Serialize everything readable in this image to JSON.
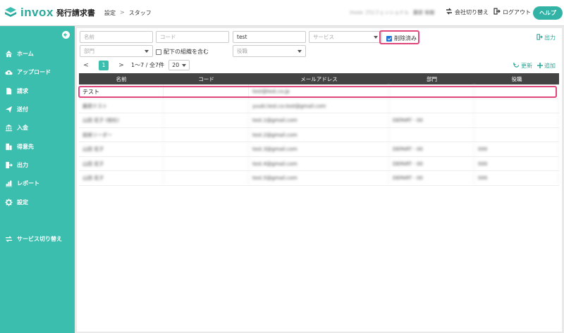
{
  "app": {
    "brand": "invox",
    "product": "発行請求書"
  },
  "breadcrumb": {
    "parent": "設定",
    "separator": ">",
    "current": "スタッフ"
  },
  "header": {
    "company": "invox プロフェッショナル",
    "user": "藤原 裕樹",
    "switch_company": "会社切り替え",
    "logout": "ログアウト",
    "help": "ヘルプ"
  },
  "sidebar": {
    "items": [
      {
        "label": "ホーム",
        "icon": "home-icon"
      },
      {
        "label": "アップロード",
        "icon": "cloud-upload-icon"
      },
      {
        "label": "請求",
        "icon": "document-icon"
      },
      {
        "label": "送付",
        "icon": "send-icon"
      },
      {
        "label": "入金",
        "icon": "bank-icon"
      },
      {
        "label": "得意先",
        "icon": "building-icon"
      },
      {
        "label": "出力",
        "icon": "export-icon"
      },
      {
        "label": "レポート",
        "icon": "chart-icon"
      },
      {
        "label": "設定",
        "icon": "gear-icon"
      },
      {
        "label": "サービス切り替え",
        "icon": "switch-icon"
      }
    ]
  },
  "filters": {
    "name_placeholder": "名前",
    "code_placeholder": "コード",
    "search_value": "test",
    "service_placeholder": "サービス",
    "deleted_label": "削除済み",
    "deleted_checked": true,
    "department_placeholder": "部門",
    "include_sub_label": "配下の組織を含む",
    "role_placeholder": "役職",
    "export_label": "出力"
  },
  "pager": {
    "prev": "<",
    "current": "1",
    "next": ">",
    "info": "1〜7 / 全7件",
    "page_size": "20"
  },
  "actions": {
    "refresh": "更新",
    "add": "追加"
  },
  "accent": "#3bbeae",
  "highlight": "#e0457b",
  "table": {
    "columns": [
      "名前",
      "コード",
      "メールアドレス",
      "部門",
      "役職"
    ],
    "rows": [
      [
        "テスト",
        "",
        "test@test.co.jp",
        "",
        ""
      ],
      [
        "藤原テスト",
        "",
        "yuuki.test.co.test@gmail.com",
        "",
        ""
      ],
      [
        "山田 花子 (他社)",
        "",
        "test.1@gmail.com",
        "DEPART - 00",
        ""
      ],
      [
        "技術リーダー",
        "",
        "test.2@gmail.com",
        "",
        ""
      ],
      [
        "山田 花子",
        "",
        "test.3@gmail.com",
        "DEPART - 00",
        "000"
      ],
      [
        "山田 花子",
        "",
        "test.4@gmail.com",
        "DEPART - 00",
        "000"
      ],
      [
        "山田 花子",
        "",
        "test.5@gmail.com",
        "DEPART - 00",
        "000"
      ]
    ]
  }
}
